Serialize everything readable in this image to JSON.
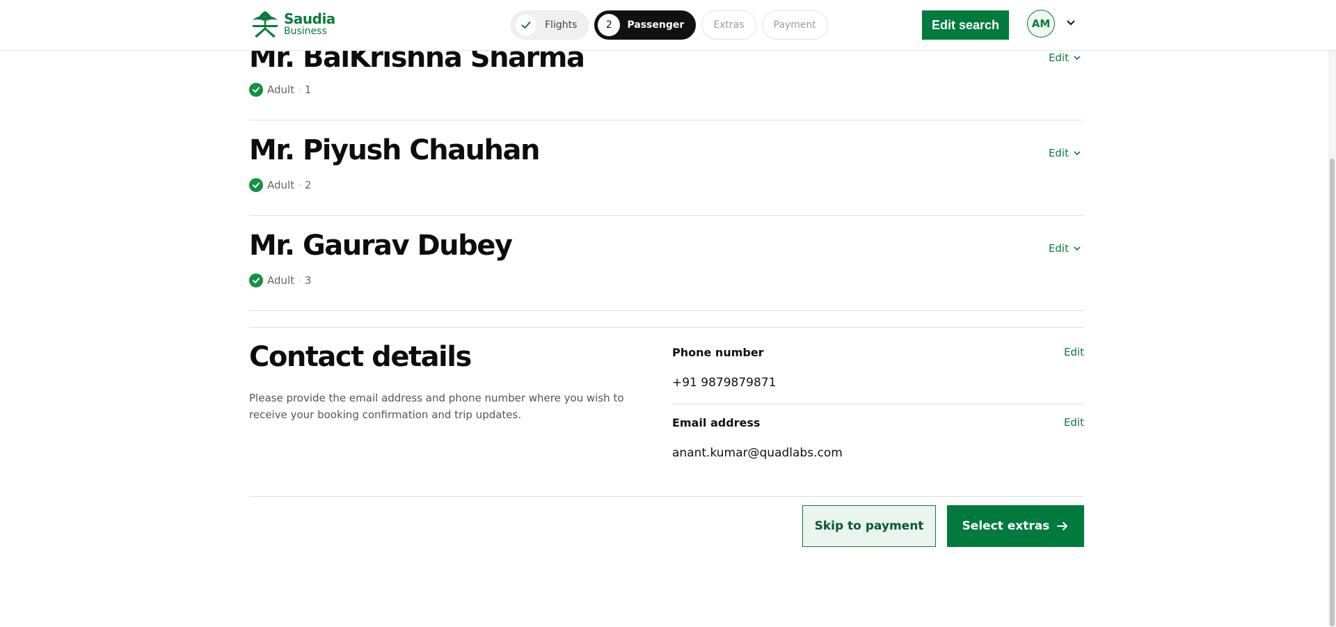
{
  "brand": {
    "name": "Saudia",
    "sub": "Business",
    "color": "#0a7a3c"
  },
  "steps": [
    {
      "label": "Flights",
      "state": "done",
      "icon": "check-icon"
    },
    {
      "number": "2",
      "label": "Passenger",
      "state": "active"
    },
    {
      "label": "Extras",
      "state": "upcoming"
    },
    {
      "label": "Payment",
      "state": "upcoming"
    }
  ],
  "header": {
    "edit_search_label": "Edit search",
    "avatar_initials": "AM"
  },
  "passengers": [
    {
      "name": "Mr. BalKrishna Sharma",
      "type": "Adult",
      "index": "1",
      "edit_label": "Edit"
    },
    {
      "name": "Mr. Piyush Chauhan",
      "type": "Adult",
      "index": "2",
      "edit_label": "Edit"
    },
    {
      "name": "Mr. Gaurav Dubey",
      "type": "Adult",
      "index": "3",
      "edit_label": "Edit"
    }
  ],
  "contact": {
    "title": "Contact details",
    "description": "Please provide the email address and phone number where you wish to receive your booking confirmation and trip updates.",
    "phone": {
      "label": "Phone number",
      "value": "+91 9879879871",
      "edit_label": "Edit"
    },
    "email": {
      "label": "Email address",
      "value": "anant.kumar@quadlabs.com",
      "edit_label": "Edit"
    }
  },
  "actions": {
    "skip_label": "Skip to payment",
    "extras_label": "Select extras"
  },
  "separator": "·"
}
